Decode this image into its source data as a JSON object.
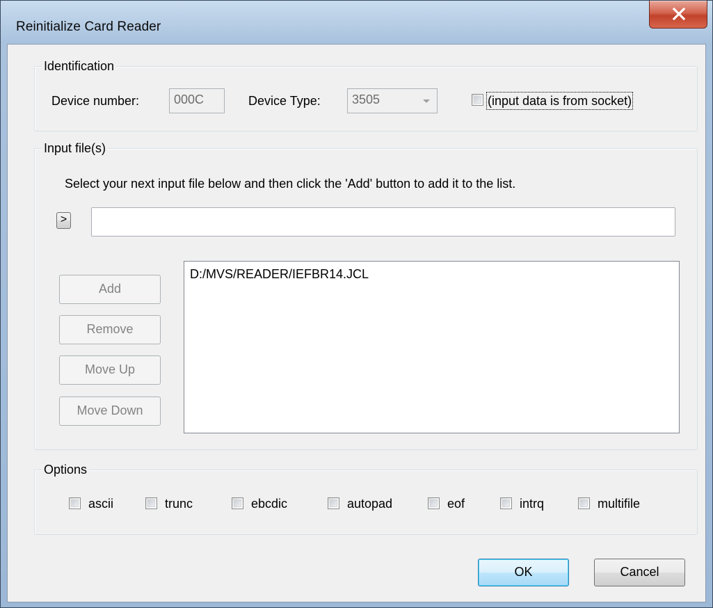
{
  "window": {
    "title": "Reinitialize Card Reader"
  },
  "identification": {
    "group_label": "Identification",
    "device_number_label": "Device number:",
    "device_number_value": "000C",
    "device_type_label": "Device Type:",
    "device_type_value": "3505",
    "socket_checkbox_label": "(input data is from socket)"
  },
  "input_files": {
    "group_label": "Input file(s)",
    "instructions": "Select your next input file below and then click the 'Add' button to add it to the list.",
    "browse_button_label": ">",
    "file_path_value": "",
    "add_label": "Add",
    "remove_label": "Remove",
    "move_up_label": "Move Up",
    "move_down_label": "Move Down",
    "files": [
      "D:/MVS/READER/IEFBR14.JCL"
    ]
  },
  "options": {
    "group_label": "Options",
    "items": [
      {
        "label": "ascii"
      },
      {
        "label": "trunc"
      },
      {
        "label": "ebcdic"
      },
      {
        "label": "autopad"
      },
      {
        "label": "eof"
      },
      {
        "label": "intrq"
      },
      {
        "label": "multifile"
      }
    ]
  },
  "footer": {
    "ok_label": "OK",
    "cancel_label": "Cancel"
  },
  "colors": {
    "dialog_background": "#f0f0f0",
    "close_button": "#c2422b",
    "default_button_border": "#3c7fb1"
  }
}
